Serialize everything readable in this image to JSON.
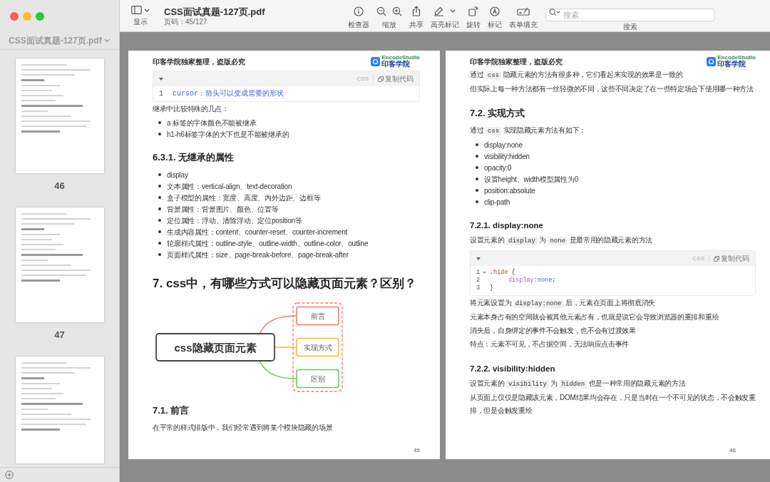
{
  "window": {
    "title": "CSS面试真题-127页.pdf",
    "subtitle": "页码：45/127"
  },
  "toolbar": {
    "view_label": "显示",
    "tools": [
      {
        "kind": "inspector",
        "label": "检查器"
      },
      {
        "kind": "zoom",
        "label": "缩放"
      },
      {
        "kind": "share",
        "label": "共享"
      },
      {
        "kind": "highlight",
        "label": "高亮标记"
      },
      {
        "kind": "rotate",
        "label": "旋转"
      },
      {
        "kind": "markup",
        "label": "标记"
      },
      {
        "kind": "form",
        "label": "表单填充"
      }
    ],
    "search": {
      "placeholder": "搜索",
      "label": "搜索"
    }
  },
  "sidebar": {
    "title": "CSS面试真题-127页.pdf",
    "thumbnails": [
      {
        "label": "46",
        "cut_off": false
      },
      {
        "label": "47",
        "cut_off": false
      },
      {
        "cut_off": true
      }
    ]
  },
  "pages": [
    {
      "header": "印客学院独家整理，盗版必究",
      "logo": {
        "brand": "EncodeStudio",
        "name": "印客学院"
      },
      "page_number": "45",
      "blocks": [
        {
          "kind": "code",
          "language": "CSS",
          "copy_label": "复制代码",
          "lines": [
            {
              "number": "1",
              "fold": false,
              "indented": false,
              "tokens": [
                {
                  "text": "cursor：箭头可以变成需要的形状",
                  "kind": "property"
                }
              ]
            }
          ]
        },
        {
          "kind": "paragraph",
          "segments": [
            {
              "text": "继承中比较特殊的几点："
            }
          ]
        },
        {
          "kind": "list",
          "items": [
            "a 标签的字体颜色不能被继承",
            "h1-h6标签字体的大下也是不能被继承的"
          ]
        },
        {
          "kind": "section_heading",
          "text": "6.3.1. 无继承的属性"
        },
        {
          "kind": "list",
          "items": [
            "display",
            "文本属性：vertical-align、text-decoration",
            "盒子模型的属性：宽度、高度、内外边距、边框等",
            "背景属性：背景图片、颜色、位置等",
            "定位属性：浮动、清除浮动、定位position等",
            "生成内容属性：content、counter-reset、counter-increment",
            "轮廓样式属性：outline-style、outline-width、outline-color、outline",
            "页面样式属性：size、page-break-before、page-break-after"
          ]
        },
        {
          "kind": "chapter_heading",
          "text": "7. css中，有哪些方式可以隐藏页面元素？区别？"
        },
        {
          "kind": "mindmap",
          "root": "css隐藏页面元素",
          "branches": [
            {
              "label": "前言",
              "color": "#f4776b"
            },
            {
              "label": "实现方式",
              "color": "#f5b83d"
            },
            {
              "label": "区别",
              "color": "#6cc655"
            }
          ]
        },
        {
          "kind": "section_heading",
          "text": "7.1. 前言"
        },
        {
          "kind": "paragraph",
          "segments": [
            {
              "text": "在平常的样式排版中，我们经常遇到将某个模块隐藏的场景"
            }
          ]
        }
      ]
    },
    {
      "header": "印客学院独家整理，盗版必究",
      "logo": {
        "brand": "EncodeStudio",
        "name": "印客学院"
      },
      "page_number": "46",
      "blocks": [
        {
          "kind": "paragraph",
          "segments": [
            {
              "text": "通过 "
            },
            {
              "text": "css",
              "code": true
            },
            {
              "text": " 隐藏元素的方法有很多种，它们看起来实现的效果是一致的"
            }
          ]
        },
        {
          "kind": "paragraph",
          "segments": [
            {
              "text": "但实际上每一种方法都有一丝轻微的不同，这些不同决定了在一些特定场合下使用哪一种方法"
            }
          ]
        },
        {
          "kind": "section_heading",
          "text": "7.2. 实现方式"
        },
        {
          "kind": "paragraph",
          "segments": [
            {
              "text": "通过 "
            },
            {
              "text": "css",
              "code": true
            },
            {
              "text": " 实现隐藏元素方法有如下："
            }
          ]
        },
        {
          "kind": "list",
          "items": [
            "display:none",
            "visibility:hidden",
            "opacity:0",
            "设置height、width模型属性为0",
            "position:absolute",
            "clip-path"
          ]
        },
        {
          "kind": "subsection_heading",
          "text": "7.2.1. display:none"
        },
        {
          "kind": "paragraph",
          "segments": [
            {
              "text": "设置元素的 "
            },
            {
              "text": "display",
              "code": true
            },
            {
              "text": " 为 "
            },
            {
              "text": "none",
              "code": true
            },
            {
              "text": " 是最常用的隐藏元素的方法"
            }
          ]
        },
        {
          "kind": "code",
          "language": "CSS",
          "copy_label": "复制代码",
          "lines": [
            {
              "number": "1",
              "fold": true,
              "indented": false,
              "tokens": [
                {
                  "text": "."
                },
                {
                  "text": "hide",
                  "kind": "selector"
                },
                {
                  "text": " {"
                }
              ]
            },
            {
              "number": "2",
              "fold": false,
              "indented": true,
              "tokens": [
                {
                  "text": "display",
                  "kind": "keyword"
                },
                {
                  "text": ":"
                },
                {
                  "text": "none",
                  "kind": "property"
                },
                {
                  "text": ";"
                }
              ]
            },
            {
              "number": "3",
              "fold": false,
              "indented": false,
              "tokens": [
                {
                  "text": "}"
                }
              ]
            }
          ]
        },
        {
          "kind": "paragraph",
          "segments": [
            {
              "text": "将元素设置为 "
            },
            {
              "text": "display:none",
              "code": true
            },
            {
              "text": " 后，元素在页面上将彻底消失"
            }
          ]
        },
        {
          "kind": "paragraph",
          "segments": [
            {
              "text": "元素本身占有的空间就会被其他元素占有，也就是说它会导致浏览器的重排和重绘"
            }
          ]
        },
        {
          "kind": "paragraph",
          "segments": [
            {
              "text": "消失后，自身绑定的事件不会触发，也不会有过渡效果"
            }
          ]
        },
        {
          "kind": "paragraph",
          "segments": [
            {
              "text": "特点：元素不可见，不占据空间，无法响应点击事件"
            }
          ]
        },
        {
          "kind": "subsection_heading",
          "text": "7.2.2. visibility:hidden"
        },
        {
          "kind": "paragraph",
          "segments": [
            {
              "text": "设置元素的 "
            },
            {
              "text": "visibility",
              "code": true
            },
            {
              "text": " 为 "
            },
            {
              "text": "hidden",
              "code": true
            },
            {
              "text": " 也是一种常用的隐藏元素的方法"
            }
          ]
        },
        {
          "kind": "paragraph",
          "segments": [
            {
              "text": "从页面上仅仅是隐藏该元素，DOM结果均会存在，只是当时在一个不可见的状态，不会触发重排，但是会触发重绘"
            }
          ]
        }
      ]
    }
  ]
}
